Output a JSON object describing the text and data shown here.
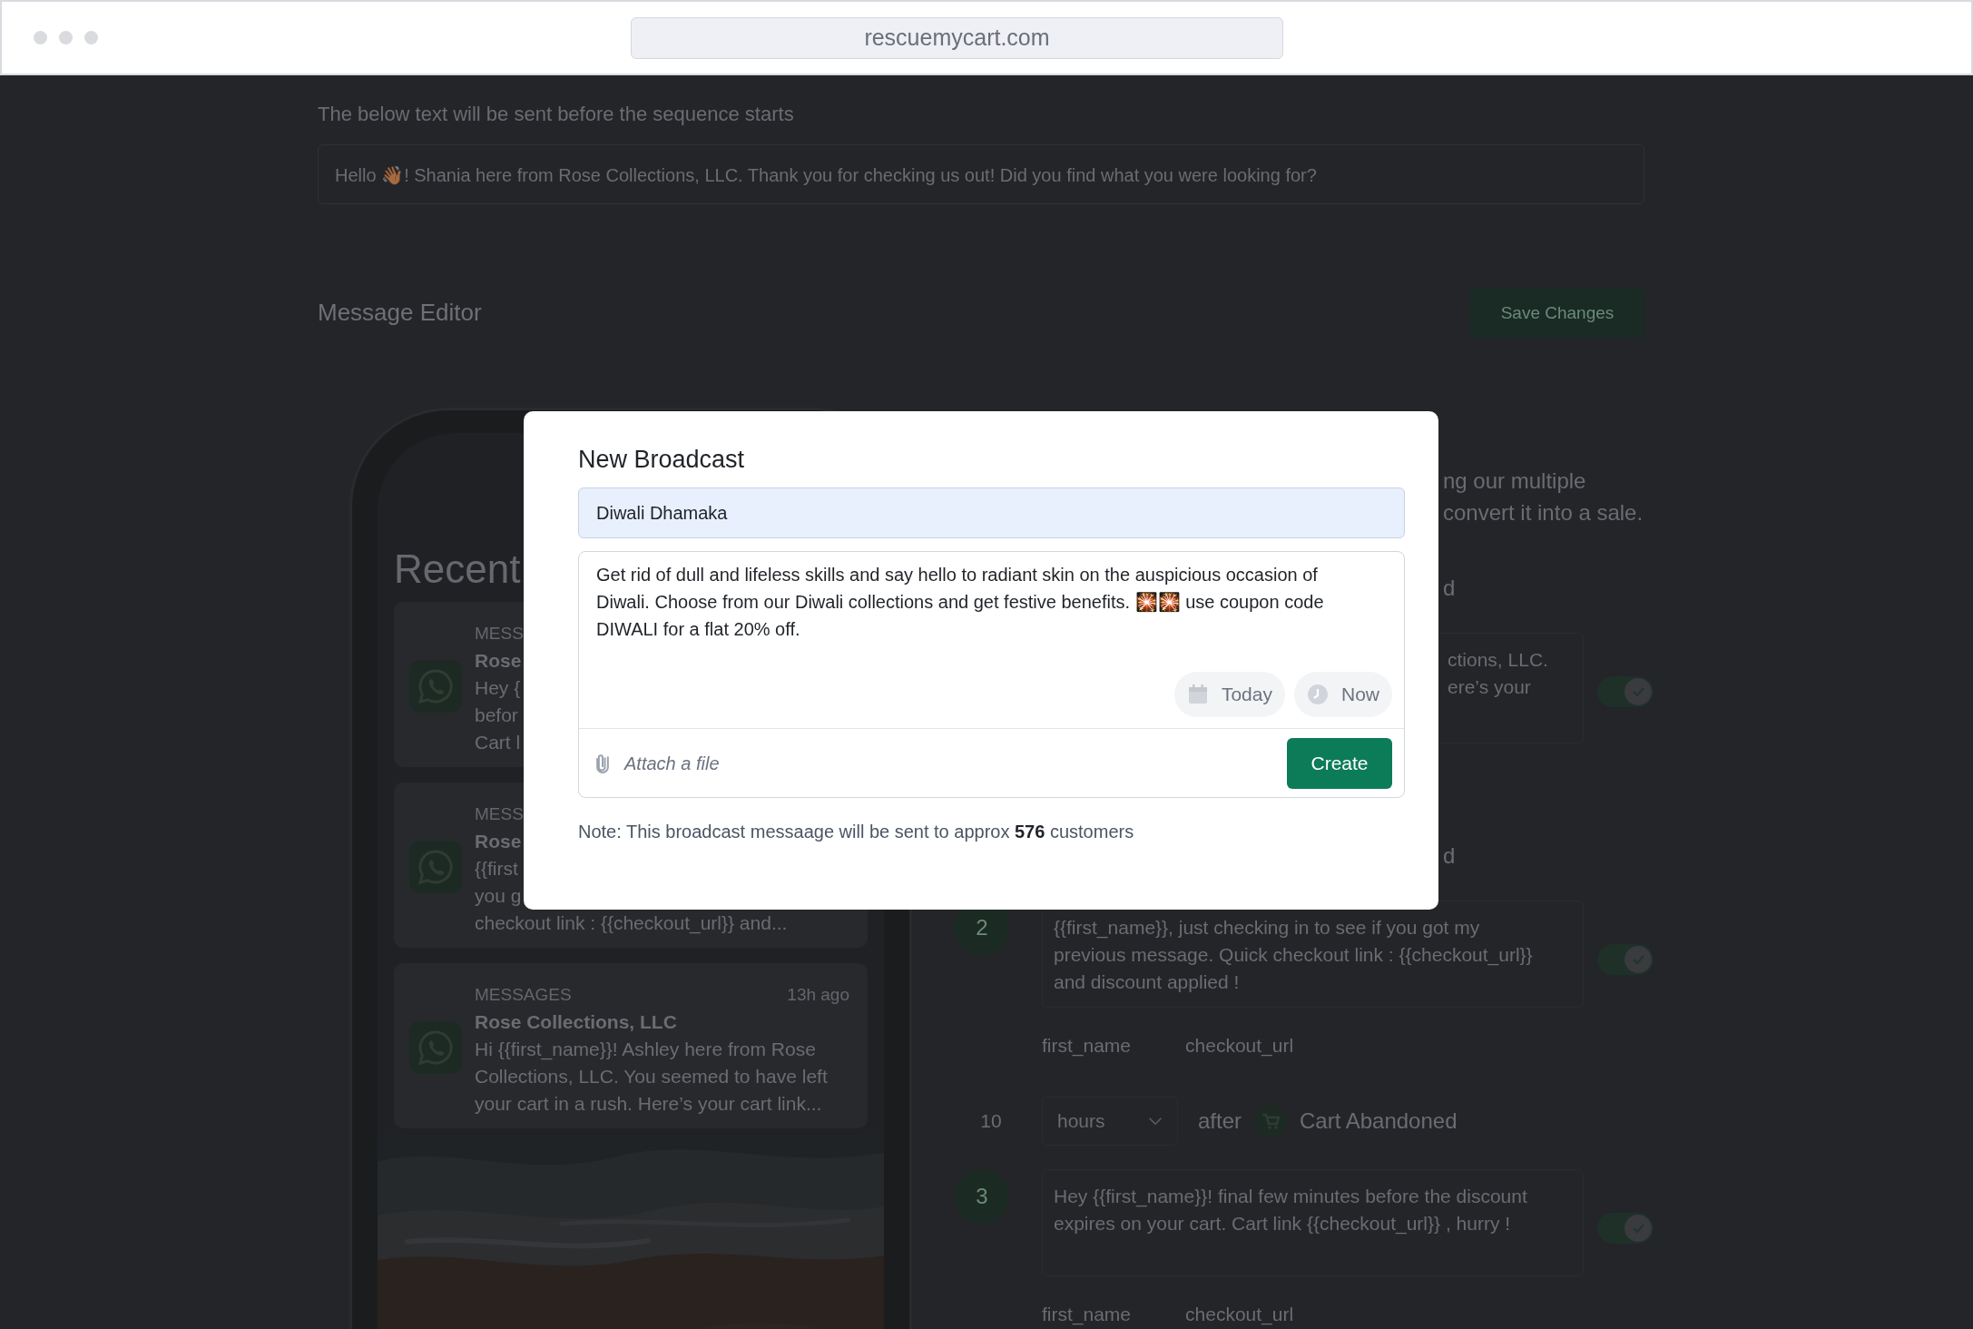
{
  "browser": {
    "url": "rescuemycart.com"
  },
  "intro": {
    "label": "The below text will be sent before the sequence starts",
    "message": "Hello 👋🏾! Shania here from Rose Collections, LLC. Thank you for checking us out! Did you find what you were looking for?"
  },
  "editor": {
    "title": "Message Editor",
    "save_button": "Save Changes"
  },
  "phone": {
    "heading": "Recent",
    "notifications": [
      {
        "app": "MESS",
        "sender": "Rose",
        "lines": [
          "Hey {",
          "befor",
          "Cart l"
        ]
      },
      {
        "app": "MESS",
        "sender": "Rose",
        "lines": [
          "{{first",
          "you g",
          "checkout link : {{checkout_url}} and..."
        ]
      },
      {
        "app": "MESSAGES",
        "time": "13h ago",
        "sender": "Rose Collections, LLC",
        "lines": [
          "Hi {{first_name}}! Ashley here from Rose",
          "Collections, LLC. You seemed to have left",
          "your cart in a rush. Here’s your cart link..."
        ]
      }
    ]
  },
  "sequence": {
    "description": [
      "ng our multiple",
      "convert it into a sale."
    ],
    "items": [
      {
        "kind": "fragment",
        "text": "d"
      },
      {
        "kind": "step_fragment",
        "lines": [
          "ctions, LLC.",
          "ere’s your"
        ],
        "on": true
      },
      {
        "kind": "fragment",
        "text": "d"
      },
      {
        "kind": "step",
        "number": "2",
        "lines": [
          "{{first_name}}, just checking in to see if you got my",
          "previous message. Quick checkout link : {{checkout_url}}",
          "and discount applied !"
        ],
        "on": true,
        "variables": [
          "first_name",
          "checkout_url"
        ]
      },
      {
        "kind": "delay",
        "amount": "10",
        "unit": "hours",
        "after": "after",
        "event": "Cart Abandoned"
      },
      {
        "kind": "step",
        "number": "3",
        "lines": [
          "Hey {{first_name}}! final few minutes before the discount",
          "expires on your cart. Cart link {{checkout_url}} , hurry !"
        ],
        "on": true,
        "variables": [
          "first_name",
          "checkout_url"
        ]
      }
    ]
  },
  "modal": {
    "title": "New Broadcast",
    "name": "Diwali Dhamaka",
    "message": "Get rid of dull and lifeless skills and say hello to radiant skin on the auspicious occasion of Diwali. Choose from our Diwali collections and get festive benefits. 🎇🎇 use coupon code DIWALI for a flat 20% off.",
    "date": "Today",
    "time": "Now",
    "attach": "Attach a file",
    "create": "Create",
    "note": "Note: This broadcast messaage will be sent to approx **576** customers"
  }
}
